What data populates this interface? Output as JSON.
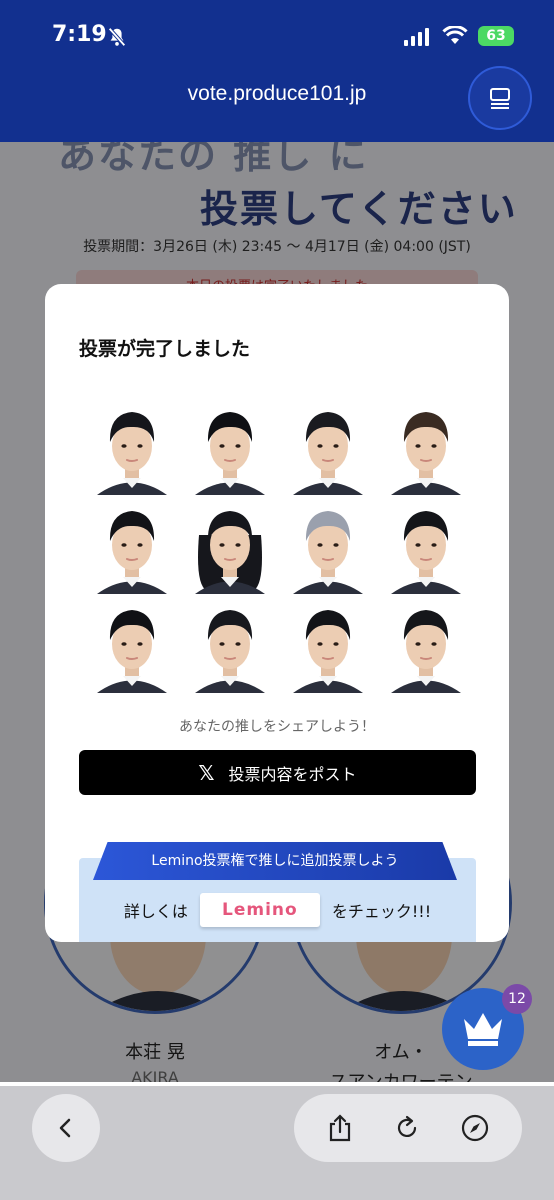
{
  "status": {
    "time": "7:19",
    "battery": "63"
  },
  "browser": {
    "url": "vote.produce101.jp"
  },
  "page": {
    "headline_top": "あなたの 推し に",
    "headline_main": "投票してください",
    "period": "投票期間：3月26日 (木) 23:45 〜 4月17日 (金) 04:00 (JST)",
    "notice": "本日の投票は完了いたしました",
    "cards": [
      {
        "name": "本荘 晃",
        "sub": "AKIRA"
      },
      {
        "name": "オム・",
        "sub": "スアンカワーテン"
      }
    ],
    "crown_badge": "12"
  },
  "modal": {
    "title": "投票が完了しました",
    "trainee_count": 12,
    "share_caption": "あなたの推しをシェアしよう！",
    "post_button": "投票内容をポスト",
    "ribbon": "Lemino投票権で推しに追加投票しよう",
    "lemino_prefix": "詳しくは",
    "lemino_logo": "Lemino",
    "lemino_suffix": "をチェック!!!"
  },
  "colors": {
    "brand": "#12308f",
    "accent": "#2c57d8",
    "badge": "#7b4aa8"
  }
}
